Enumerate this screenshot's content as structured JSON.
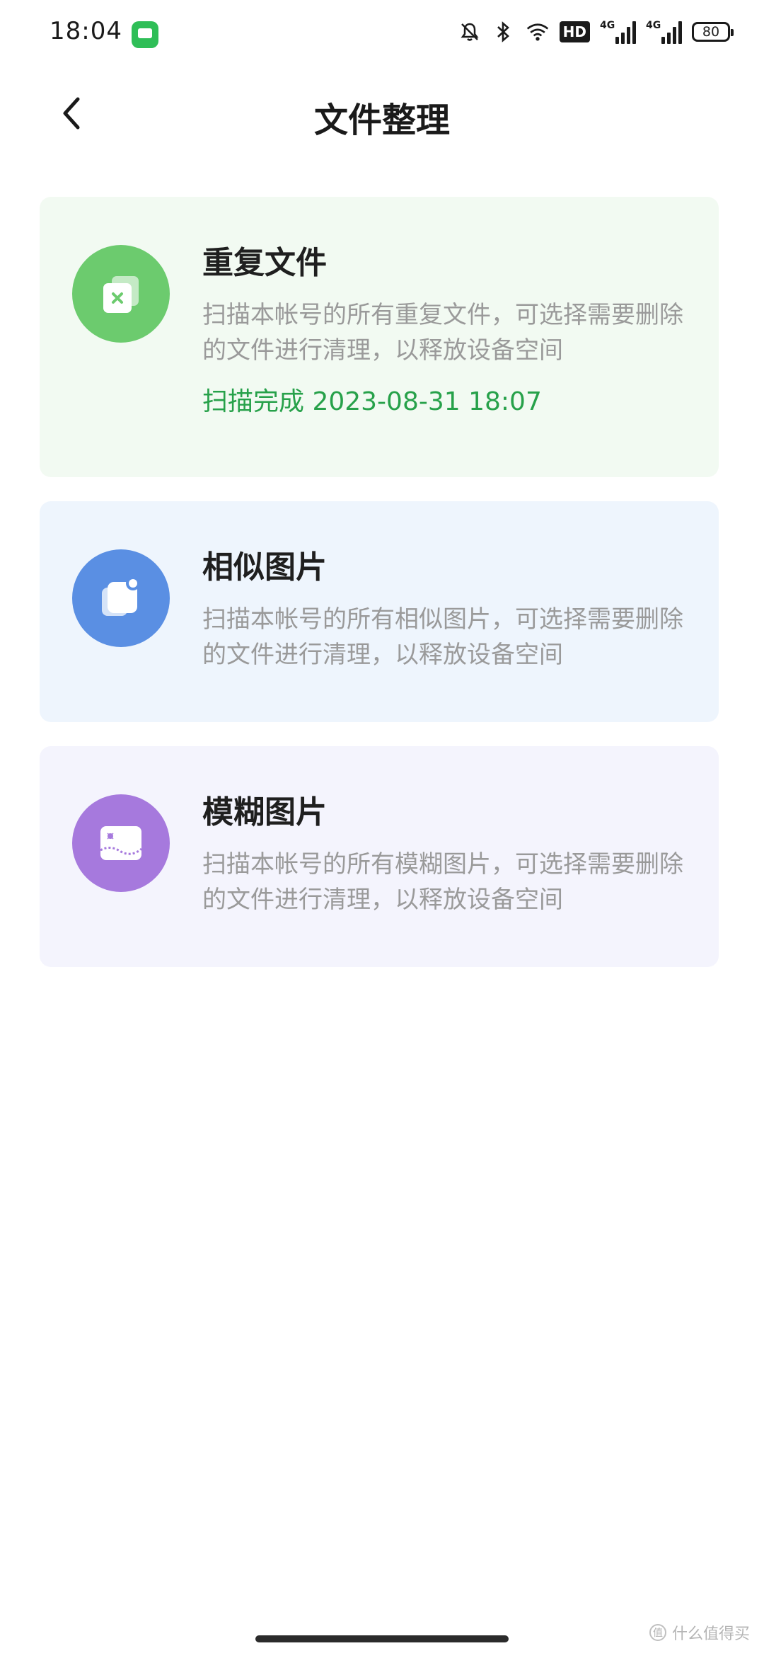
{
  "status_bar": {
    "time": "18:04",
    "hd_label": "HD",
    "signal_1": "4G",
    "signal_2": "4G",
    "battery": "80"
  },
  "header": {
    "title": "文件整理"
  },
  "cards": [
    {
      "title": "重复文件",
      "description": "扫描本帐号的所有重复文件，可选择需要删除的文件进行清理，以释放设备空间",
      "status": "扫描完成 2023-08-31 18:07",
      "icon": "duplicate-files-icon",
      "color": "#6ccb6e"
    },
    {
      "title": "相似图片",
      "description": "扫描本帐号的所有相似图片，可选择需要删除的文件进行清理，以释放设备空间",
      "icon": "similar-images-icon",
      "color": "#5a8fe3"
    },
    {
      "title": "模糊图片",
      "description": "扫描本帐号的所有模糊图片，可选择需要删除的文件进行清理，以释放设备空间",
      "icon": "blurry-images-icon",
      "color": "#a679dd"
    }
  ],
  "watermark": {
    "badge": "值",
    "text": "什么值得买"
  }
}
